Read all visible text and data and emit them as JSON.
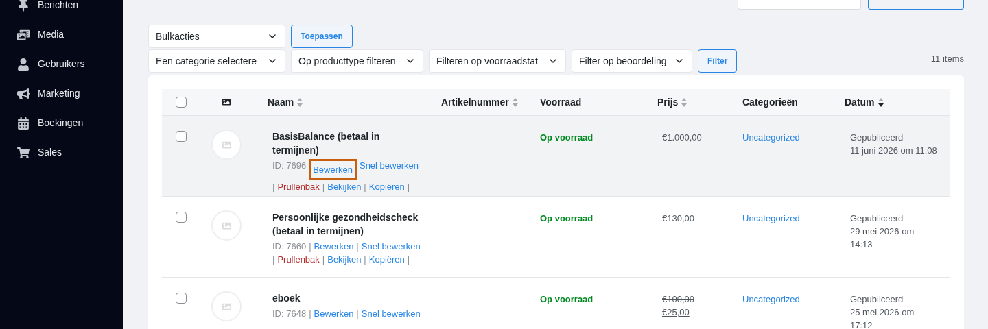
{
  "sidebar": {
    "items": [
      {
        "label": "Berichten",
        "kind": "pin"
      },
      {
        "label": "Media",
        "kind": "media"
      },
      {
        "label": "Gebruikers",
        "kind": "user"
      },
      {
        "label": "Marketing",
        "kind": "megaphone"
      },
      {
        "label": "Boekingen",
        "kind": "calendar"
      },
      {
        "label": "Sales",
        "kind": "cart"
      }
    ]
  },
  "bulk_actions": {
    "select": "Bulkacties",
    "button": "Toepassen"
  },
  "filters": {
    "selects": [
      "Een categorie selectere",
      "Op producttype filteren",
      "Filteren op voorraadstat",
      "Filter op beoordeling"
    ],
    "button": "Filter"
  },
  "item_count": "11 items",
  "table": {
    "columns": [
      {
        "kind": "checkbox",
        "checked": false
      },
      {
        "kind": "image"
      },
      {
        "kind": "text",
        "label": "Naam",
        "sortable": true,
        "sorted": false
      },
      {
        "kind": "text",
        "label": "Artikelnummer",
        "sortable": true,
        "sorted": false
      },
      {
        "kind": "text",
        "label": "Voorraad",
        "sortable": false
      },
      {
        "kind": "text",
        "label": "Prijs",
        "sortable": true,
        "sorted": false
      },
      {
        "kind": "text",
        "label": "Categorieën",
        "sortable": false
      },
      {
        "kind": "text",
        "label": "Datum",
        "sortable": true,
        "sorted": true
      }
    ],
    "rows": [
      {
        "checked": false,
        "highlighted": true,
        "name": "BasisBalance (betaal in termijnen)",
        "actions": [
          {
            "kind": "id",
            "label": "ID: 7696"
          },
          {
            "kind": "link",
            "label": "Bewerken",
            "highlighted": true
          },
          {
            "kind": "link",
            "label": "Snel bewerken"
          },
          {
            "kind": "sep",
            "label": "|"
          },
          {
            "kind": "danger",
            "label": "Prullenbak"
          },
          {
            "kind": "sep",
            "label": "|"
          },
          {
            "kind": "link",
            "label": "Bekijken"
          },
          {
            "kind": "sep",
            "label": "|"
          },
          {
            "kind": "link",
            "label": "Kopiëren"
          },
          {
            "kind": "sep",
            "label": "|"
          }
        ],
        "sku": "–",
        "stock": "Op voorraad",
        "price": [
          {
            "kind": "regular",
            "text": "€1.000,00"
          }
        ],
        "category": "Uncategorized",
        "date_lines": [
          "Gepubliceerd",
          "11 juni 2026 om 11:08"
        ]
      },
      {
        "checked": false,
        "highlighted": false,
        "name": "Persoonlijke gezondheidscheck (betaal in termijnen)",
        "actions": [
          {
            "kind": "id",
            "label": "ID: 7660"
          },
          {
            "kind": "sep",
            "label": "|"
          },
          {
            "kind": "link",
            "label": "Bewerken"
          },
          {
            "kind": "sep",
            "label": "|"
          },
          {
            "kind": "link",
            "label": "Snel bewerken"
          },
          {
            "kind": "sep",
            "label": "|"
          },
          {
            "kind": "danger",
            "label": "Prullenbak"
          },
          {
            "kind": "sep",
            "label": "|"
          },
          {
            "kind": "link",
            "label": "Bekijken"
          },
          {
            "kind": "sep",
            "label": "|"
          },
          {
            "kind": "link",
            "label": "Kopiëren"
          },
          {
            "kind": "sep",
            "label": "|"
          }
        ],
        "sku": "–",
        "stock": "Op voorraad",
        "price": [
          {
            "kind": "regular",
            "text": "€130,00"
          }
        ],
        "category": "Uncategorized",
        "date_lines": [
          "Gepubliceerd",
          "29 mei 2026 om",
          "14:13"
        ]
      },
      {
        "checked": false,
        "highlighted": false,
        "name": "eboek",
        "actions": [
          {
            "kind": "id",
            "label": "ID: 7648"
          },
          {
            "kind": "sep",
            "label": "|"
          },
          {
            "kind": "link",
            "label": "Bewerken"
          },
          {
            "kind": "sep",
            "label": "|"
          },
          {
            "kind": "link",
            "label": "Snel bewerken"
          }
        ],
        "sku": "–",
        "stock": "Op voorraad",
        "price": [
          {
            "kind": "old",
            "text": "€100,00"
          },
          {
            "kind": "sale",
            "text": "€25,00"
          }
        ],
        "category": "Uncategorized",
        "date_lines": [
          "Gepubliceerd",
          "25 mei 2026 om",
          "17:12"
        ]
      }
    ]
  }
}
